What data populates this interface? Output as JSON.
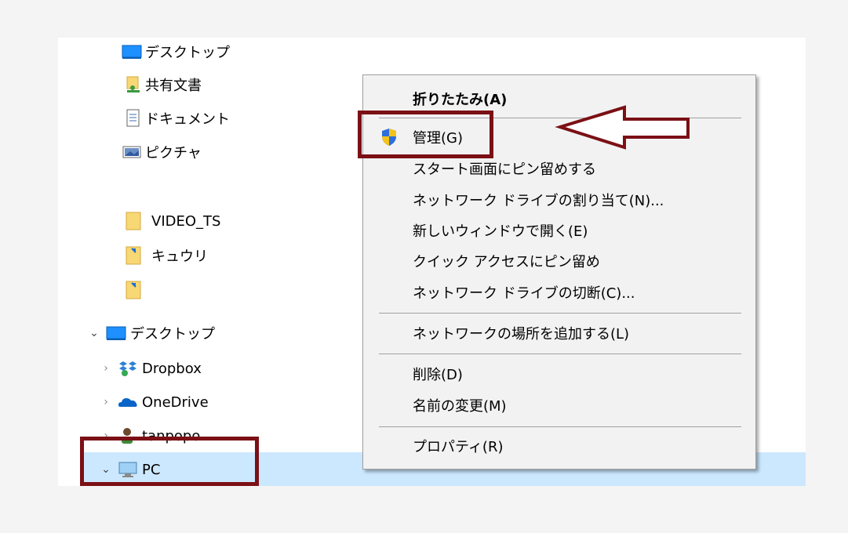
{
  "tree": {
    "items": [
      {
        "label": "デスクトップ",
        "icon": "desktop-icon"
      },
      {
        "label": "共有文書",
        "icon": "shared-folder-icon"
      },
      {
        "label": "ドキュメント",
        "icon": "document-icon"
      },
      {
        "label": "ピクチャ",
        "icon": "picture-icon"
      },
      {
        "label": "VIDEO_TS",
        "icon": "folder-icon"
      },
      {
        "label": "キュウリ",
        "icon": "folder-shortcut-icon"
      },
      {
        "label": "",
        "icon": "folder-shortcut-icon"
      },
      {
        "label": "デスクトップ",
        "icon": "desktop-icon",
        "expanded": true
      },
      {
        "label": "Dropbox",
        "icon": "dropbox-icon",
        "expanded": false
      },
      {
        "label": "OneDrive",
        "icon": "onedrive-icon",
        "expanded": false
      },
      {
        "label": "tanpopo",
        "icon": "user-icon",
        "expanded": false
      },
      {
        "label": "PC",
        "icon": "pc-icon",
        "expanded": true,
        "selected": true
      }
    ]
  },
  "context_menu": {
    "items": [
      {
        "label": "折りたたみ(A)",
        "bold": true
      },
      {
        "label": "管理(G)",
        "icon": "uac-shield-icon"
      },
      {
        "label": "スタート画面にピン留めする"
      },
      {
        "label": "ネットワーク ドライブの割り当て(N)..."
      },
      {
        "label": "新しいウィンドウで開く(E)"
      },
      {
        "label": "クイック アクセスにピン留め"
      },
      {
        "label": "ネットワーク ドライブの切断(C)..."
      },
      {
        "label": "ネットワークの場所を追加する(L)"
      },
      {
        "label": "削除(D)"
      },
      {
        "label": "名前の変更(M)"
      },
      {
        "label": "プロパティ(R)"
      }
    ]
  },
  "annotations": {
    "highlight_color": "#7b1015",
    "arrow_target": "管理(G)"
  },
  "colors": {
    "selection": "#cce8ff",
    "menu_background": "#f2f2f2",
    "folder_yellow": "#f8d775"
  }
}
